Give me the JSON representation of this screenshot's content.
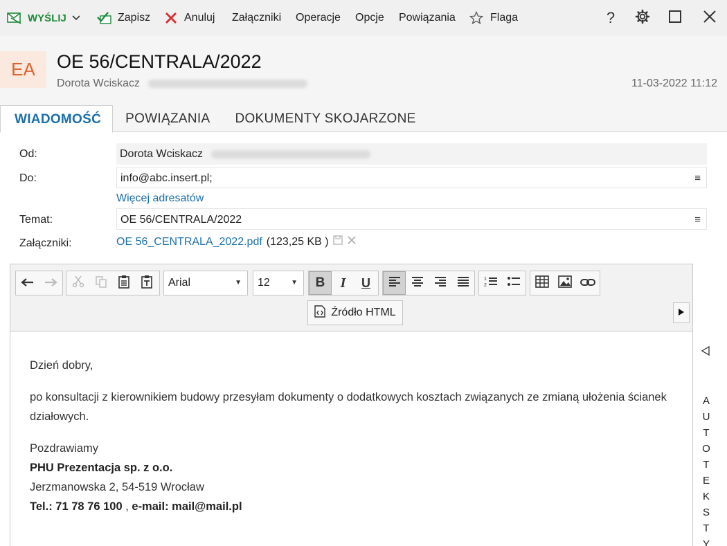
{
  "toolbar": {
    "send_label": "WYŚLIJ",
    "save_label": "Zapisz",
    "cancel_label": "Anuluj",
    "attachments_label": "Załączniki",
    "operations_label": "Operacje",
    "options_label": "Opcje",
    "relations_label": "Powiązania",
    "flag_label": "Flaga",
    "help_glyph": "?"
  },
  "header": {
    "avatar_initials": "EA",
    "title": "OE 56/CENTRALA/2022",
    "from_name": "Dorota Wciskacz",
    "date": "11-03-2022 11:12"
  },
  "tabs": [
    {
      "label": "WIADOMOŚĆ"
    },
    {
      "label": "POWIĄZANIA"
    },
    {
      "label": "DOKUMENTY SKOJARZONE"
    }
  ],
  "form": {
    "from_label": "Od:",
    "from_value": "Dorota Wciskacz",
    "to_label": "Do:",
    "to_value": "info@abc.insert.pl;",
    "more_recipients": "Więcej adresatów",
    "subject_label": "Temat:",
    "subject_value": "OE 56/CENTRALA/2022",
    "attachments_label": "Załączniki:",
    "attachment_name": "OE 56_CENTRALA_2022.pdf",
    "attachment_size": "(123,25 KB )",
    "menu_glyph": "≡"
  },
  "editor": {
    "font": "Arial",
    "font_size": "12",
    "source_label": "Źródło HTML",
    "body": {
      "greeting": "Dzień dobry,",
      "paragraph": "po konsultacji z kierownikiem budowy przesyłam dokumenty o dodatkowych kosztach związanych ze zmianą ułożenia ścianek działowych.",
      "closing": "Pozdrawiamy",
      "company": "PHU Prezentacja sp. z o.o.",
      "address": "Jerzmanowska 2, 54-519 Wrocław",
      "phone": "Tel.: 71 78 76 100",
      "separator": " , ",
      "email": "e-mail: mail@mail.pl"
    }
  },
  "side_panel": {
    "label_letters": [
      "A",
      "U",
      "T",
      "O",
      "T",
      "E",
      "K",
      "S",
      "T",
      "Y"
    ]
  },
  "colors": {
    "accent_blue": "#1b6fa8",
    "send_green": "#1e8a3a",
    "cancel_red": "#d92b2b",
    "avatar_orange": "#d9662d"
  }
}
